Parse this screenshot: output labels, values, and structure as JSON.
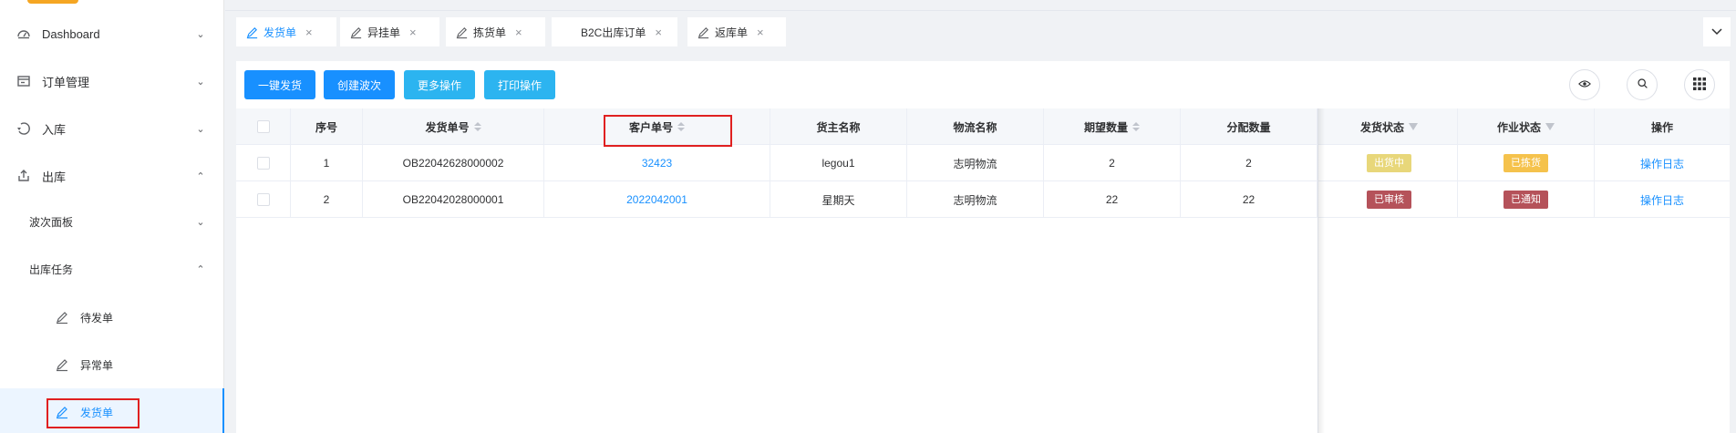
{
  "sidebar": {
    "items": [
      {
        "label": "Dashboard",
        "icon": "dashboard-icon",
        "arrow": "⌄"
      },
      {
        "label": "订单管理",
        "icon": "order-icon",
        "arrow": "⌄"
      },
      {
        "label": "入库",
        "icon": "inbound-icon",
        "arrow": "⌄"
      },
      {
        "label": "出库",
        "icon": "outbound-icon",
        "arrow": "⌃"
      }
    ],
    "sub_items": [
      {
        "label": "波次面板",
        "arrow": "⌄"
      },
      {
        "label": "出库任务",
        "arrow": "⌃"
      }
    ],
    "leaf_items": [
      {
        "label": "待发单"
      },
      {
        "label": "异常单"
      },
      {
        "label": "发货单"
      }
    ]
  },
  "tabs": [
    {
      "label": "发货单",
      "close": "×"
    },
    {
      "label": "异挂单",
      "close": "×"
    },
    {
      "label": "拣货单",
      "close": "×"
    },
    {
      "label": "B2C出库订单",
      "close": "×"
    },
    {
      "label": "返库单",
      "close": "×"
    }
  ],
  "toolbar": {
    "buttons": [
      "一键发货",
      "创建波次",
      "更多操作",
      "打印操作"
    ]
  },
  "table": {
    "headers": [
      "序号",
      "发货单号",
      "客户单号",
      "货主名称",
      "物流名称",
      "期望数量",
      "分配数量",
      "发货状态",
      "作业状态",
      "操作"
    ],
    "rows": [
      {
        "index": "1",
        "order_no": "OB22042628000002",
        "customer_no": "32423",
        "owner": "legou1",
        "logistics": "志明物流",
        "expected": "2",
        "allocated": "2",
        "ship_status": "出货中",
        "work_status": "已拣货",
        "action": "操作日志"
      },
      {
        "index": "2",
        "order_no": "OB22042028000001",
        "customer_no": "2022042001",
        "owner": "星期天",
        "logistics": "志明物流",
        "expected": "22",
        "allocated": "22",
        "ship_status": "已审核",
        "work_status": "已通知",
        "action": "操作日志"
      }
    ]
  },
  "colors": {
    "primary": "#1890ff",
    "cyan": "#2cb4f0",
    "tag_yellow": "#e8d77a",
    "tag_orange": "#f5c24c",
    "tag_red": "#b5525a",
    "highlight_red": "#e02020"
  }
}
